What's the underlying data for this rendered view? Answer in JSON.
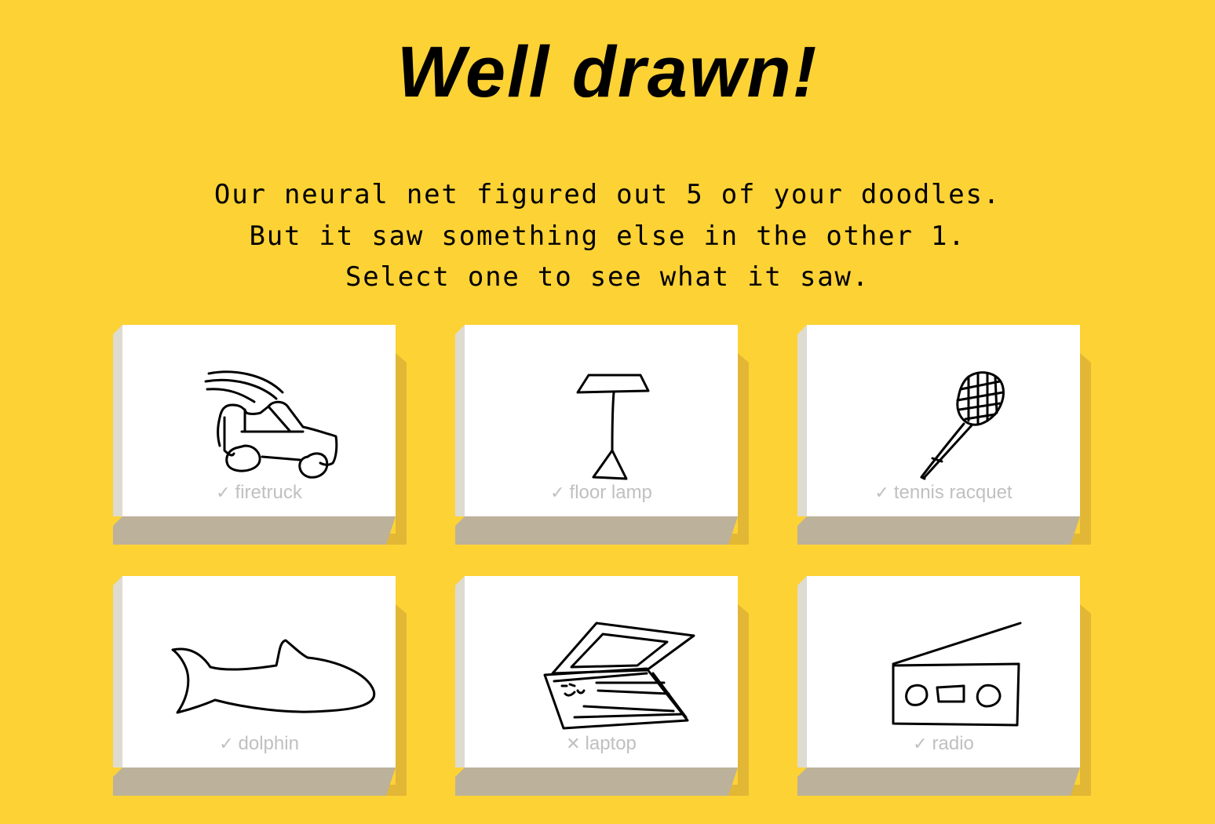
{
  "heading": {
    "title": "Well drawn!"
  },
  "message": {
    "line1": "Our neural net figured out 5 of your doodles.",
    "line2": "But it saw something else in the other 1.",
    "line3": "Select one to see what it saw."
  },
  "doodles": [
    {
      "label": "firetruck",
      "mark": "✓",
      "recognized": true,
      "icon": "firetruck-doodle-icon"
    },
    {
      "label": "floor lamp",
      "mark": "✓",
      "recognized": true,
      "icon": "floor-lamp-doodle-icon"
    },
    {
      "label": "tennis racquet",
      "mark": "✓",
      "recognized": true,
      "icon": "tennis-racquet-doodle-icon"
    },
    {
      "label": "dolphin",
      "mark": "✓",
      "recognized": true,
      "icon": "dolphin-doodle-icon"
    },
    {
      "label": "laptop",
      "mark": "✕",
      "recognized": false,
      "icon": "laptop-doodle-icon"
    },
    {
      "label": "radio",
      "mark": "✓",
      "recognized": true,
      "icon": "radio-doodle-icon"
    }
  ],
  "colors": {
    "background": "#fdd235",
    "card_face": "#ffffff",
    "card_left": "#dedbd0",
    "card_bottom": "#bcb19b",
    "card_shadow": "#e2b735",
    "caption_text": "#c0c0c0",
    "ink": "#000000"
  }
}
